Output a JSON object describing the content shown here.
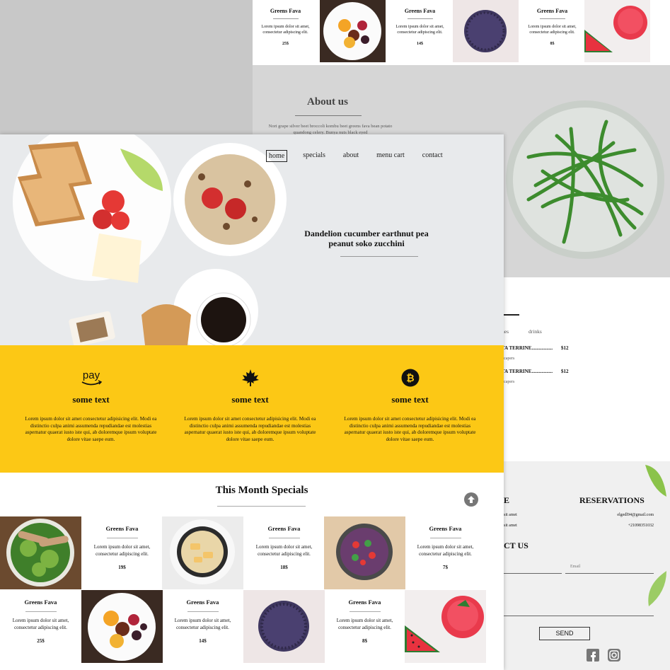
{
  "background_page": {
    "specials_row": [
      {
        "type": "text",
        "title": "Greens Fava",
        "desc": "Lorem ipsum dolor sit amet, consectetur adipiscing elit.",
        "price": "25$"
      },
      {
        "type": "image",
        "alt": "fruit-plate"
      },
      {
        "type": "text",
        "title": "Greens Fava",
        "desc": "Lorem ipsum dolor sit amet, consectetur adipiscing elit.",
        "price": "14$"
      },
      {
        "type": "image",
        "alt": "donut"
      },
      {
        "type": "text",
        "title": "Greens Fava",
        "desc": "Lorem ipsum dolor sit amet, consectetur adipiscing elit.",
        "price": "8$"
      },
      {
        "type": "image",
        "alt": "watermelon-drink"
      }
    ],
    "about": {
      "title": "About us",
      "text": "Nori grape silver beet broccoli kombu beet greens fava bean potato quandong celery. Bunya nuts black eyed"
    },
    "menu": {
      "tabs": [
        "hes",
        "drinks"
      ],
      "items": [
        {
          "name": "TA TERRINE.................",
          "price": "$12",
          "desc": ", capers"
        },
        {
          "name": "TA TERRINE.................",
          "price": "$12",
          "desc": ", capers"
        }
      ]
    },
    "footer": {
      "reservations_title": "RESERVATIONS",
      "left_heading_fragment": "E",
      "left_lines": [
        "sit amet",
        "sit amet"
      ],
      "email": "elgedl94@gmail.com",
      "phone": "+21098351032",
      "contact_title": "CT US",
      "email_placeholder": "Email",
      "send_label": "SEND"
    }
  },
  "foreground_page": {
    "nav": [
      "home",
      "specials",
      "about",
      "menu cart",
      "contact"
    ],
    "hero_title": "Dandelion cucumber earthnut pea peanut soko zucchini",
    "features": [
      {
        "icon": "amazon-pay-icon",
        "icon_text": "pay",
        "title": "some text",
        "text": "Lorem ipsum dolor sit amet consectetur adipisicing elit. Modi ea distinctio culpa animi assumenda repudiandae est molestias aspernatur quaerat iusto iste qui, ab doloremque ipsum voluptate dolore vitae saepe eum."
      },
      {
        "icon": "maple-leaf-icon",
        "title": "some text",
        "text": "Lorem ipsum dolor sit amet consectetur adipisicing elit. Modi ea distinctio culpa animi assumenda repudiandae est molestias aspernatur quaerat iusto iste qui, ab doloremque ipsum voluptate dolore vitae saepe eum."
      },
      {
        "icon": "bitcoin-icon",
        "icon_text": "₿",
        "title": "some text",
        "text": "Lorem ipsum dolor sit amet consectetur adipisicing elit. Modi ea distinctio culpa animi assumenda repudiandae est molestias aspernatur quaerat iusto iste qui, ab doloremque ipsum voluptate dolore vitae saepe eum."
      }
    ],
    "specials": {
      "title": "This Month Specials",
      "cells": [
        {
          "type": "image",
          "alt": "salad"
        },
        {
          "type": "text",
          "title": "Greens Fava",
          "desc": "Lorem ipsum dolor sit amet, consectetur adipiscing elit.",
          "price": "19$"
        },
        {
          "type": "image",
          "alt": "pot-dish"
        },
        {
          "type": "text",
          "title": "Greens Fava",
          "desc": "Lorem ipsum dolor sit amet, consectetur adipiscing elit.",
          "price": "18$"
        },
        {
          "type": "image",
          "alt": "vegetable-bowl"
        },
        {
          "type": "text",
          "title": "Greens Fava",
          "desc": "Lorem ipsum dolor sit amet, consectetur adipiscing elit.",
          "price": "7$"
        },
        {
          "type": "text",
          "title": "Greens Fava",
          "desc": "Lorem ipsum dolor sit amet, consectetur adipiscing elit.",
          "price": "25$"
        },
        {
          "type": "image",
          "alt": "fruit-plate"
        },
        {
          "type": "text",
          "title": "Greens Fava",
          "desc": "Lorem ipsum dolor sit amet, consectetur adipiscing elit.",
          "price": "14$"
        },
        {
          "type": "image",
          "alt": "donut"
        },
        {
          "type": "text",
          "title": "Greens Fava",
          "desc": "Lorem ipsum dolor sit amet, consectetur adipiscing elit.",
          "price": "8$"
        },
        {
          "type": "image",
          "alt": "watermelon-drink"
        }
      ]
    }
  },
  "colors": {
    "accent_yellow": "#fcc815",
    "about_bg": "#d6d6d6",
    "gray_bg": "#c8c8c8"
  }
}
